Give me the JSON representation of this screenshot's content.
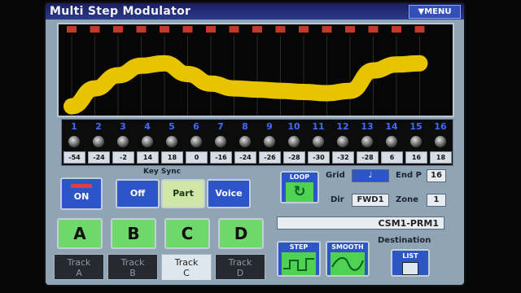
{
  "window": {
    "title": "Multi Step Modulator",
    "menu_label": "▼MENU"
  },
  "steps": [
    {
      "num": "1",
      "value": "-54"
    },
    {
      "num": "2",
      "value": "-24"
    },
    {
      "num": "3",
      "value": "-2"
    },
    {
      "num": "4",
      "value": "14"
    },
    {
      "num": "5",
      "value": "18"
    },
    {
      "num": "6",
      "value": "0"
    },
    {
      "num": "7",
      "value": "-16"
    },
    {
      "num": "8",
      "value": "-24"
    },
    {
      "num": "9",
      "value": "-26"
    },
    {
      "num": "10",
      "value": "-28"
    },
    {
      "num": "11",
      "value": "-30"
    },
    {
      "num": "12",
      "value": "-32"
    },
    {
      "num": "13",
      "value": "-28"
    },
    {
      "num": "14",
      "value": "6"
    },
    {
      "num": "15",
      "value": "16"
    },
    {
      "num": "16",
      "value": "18"
    }
  ],
  "controls": {
    "on_label": "ON",
    "key_sync_label": "Key Sync",
    "key_sync_options": [
      "Off",
      "Part",
      "Voice"
    ],
    "key_sync_selected": "Part",
    "sections": [
      "A",
      "B",
      "C",
      "D"
    ],
    "tracks": [
      {
        "line1": "Track",
        "line2": "A"
      },
      {
        "line1": "Track",
        "line2": "B"
      },
      {
        "line1": "Track",
        "line2": "C"
      },
      {
        "line1": "Track",
        "line2": "D"
      }
    ],
    "active_track": "C"
  },
  "right_panel": {
    "loop_label": "LOOP",
    "grid_label": "Grid",
    "grid_value": "♩",
    "endp_label": "End P",
    "endp_value": "16",
    "dir_label": "Dir",
    "dir_value": "FWD1",
    "zone_label": "Zone",
    "zone_value": "1",
    "program_name": "CSM1-PRM1",
    "step_label": "STEP",
    "smooth_label": "SMOOTH",
    "destination_label": "Destination",
    "list_label": "LIST"
  },
  "colors": {
    "wave": "#e8c400",
    "accent": "#2b55c8",
    "active": "#6fd86a"
  }
}
